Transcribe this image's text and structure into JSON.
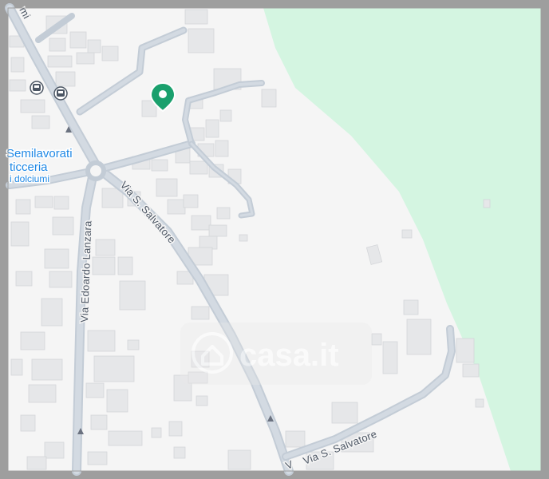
{
  "map": {
    "colors": {
      "land": "#f5f5f5",
      "park": "#d4f5e1",
      "road": "#c3ccd6",
      "building": "#e6e7e9",
      "marker": "#1aa06d",
      "poi_text": "#1e88e5",
      "road_text": "#4b5563",
      "frame": "#9e9e9e"
    },
    "roads": {
      "via_s_salvatore_main": "Via S. Salvatore",
      "via_s_salvatore_lower": "Via S. Salvatore",
      "via_edoardo_lanzara": "Via Edoardo Lanzara",
      "top_left_partial": "mi",
      "bottom_partial": "V"
    },
    "poi": {
      "name_line1": "Semilavorati",
      "name_line2": "ticceria",
      "category": "i dolciumi",
      "icon": "bus-stop-icon"
    },
    "marker": {
      "icon": "location-pin-icon"
    },
    "watermark": {
      "text": "casa.it",
      "icon": "house-icon"
    }
  }
}
